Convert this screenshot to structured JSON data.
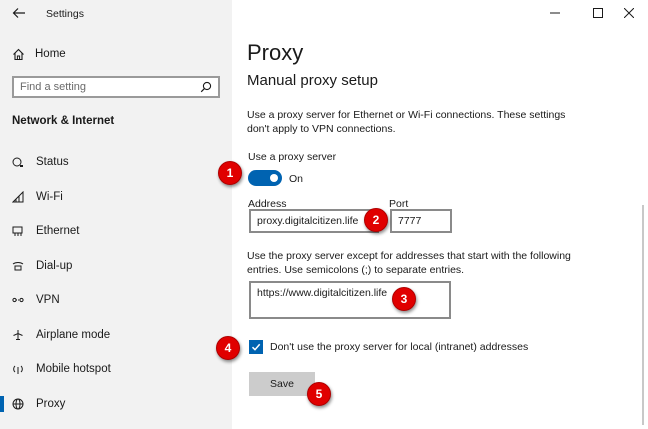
{
  "window": {
    "title": "Settings",
    "controls": {
      "minimize": "─",
      "maximize": "☐",
      "close": "✕"
    }
  },
  "sidebar": {
    "home_label": "Home",
    "search_placeholder": "Find a setting",
    "section_heading": "Network & Internet",
    "items": [
      {
        "label": "Status",
        "icon": "status-icon",
        "active": false
      },
      {
        "label": "Wi-Fi",
        "icon": "wifi-icon",
        "active": false
      },
      {
        "label": "Ethernet",
        "icon": "ethernet-icon",
        "active": false
      },
      {
        "label": "Dial-up",
        "icon": "dialup-icon",
        "active": false
      },
      {
        "label": "VPN",
        "icon": "vpn-icon",
        "active": false
      },
      {
        "label": "Airplane mode",
        "icon": "airplane-icon",
        "active": false
      },
      {
        "label": "Mobile hotspot",
        "icon": "hotspot-icon",
        "active": false
      },
      {
        "label": "Proxy",
        "icon": "globe-icon",
        "active": true
      }
    ]
  },
  "main": {
    "title": "Proxy",
    "subtitle": "Manual proxy setup",
    "description": "Use a proxy server for Ethernet or Wi-Fi connections. These settings don't apply to VPN connections.",
    "use_proxy_label": "Use a proxy server",
    "toggle_state": "On",
    "address_label": "Address",
    "address_value": "proxy.digitalcitizen.life",
    "port_label": "Port",
    "port_value": "7777",
    "exceptions_description": "Use the proxy server except for addresses that start with the following entries. Use semicolons (;) to separate entries.",
    "exceptions_value": "https://www.digitalcitizen.life",
    "local_checkbox_label": "Don't use the proxy server for local (intranet) addresses",
    "local_checkbox_checked": true,
    "save_label": "Save"
  },
  "callouts": [
    "1",
    "2",
    "3",
    "4",
    "5"
  ],
  "colors": {
    "accent": "#0063b1",
    "callout": "#e00000",
    "sidebar_bg": "#f2f2f2"
  }
}
